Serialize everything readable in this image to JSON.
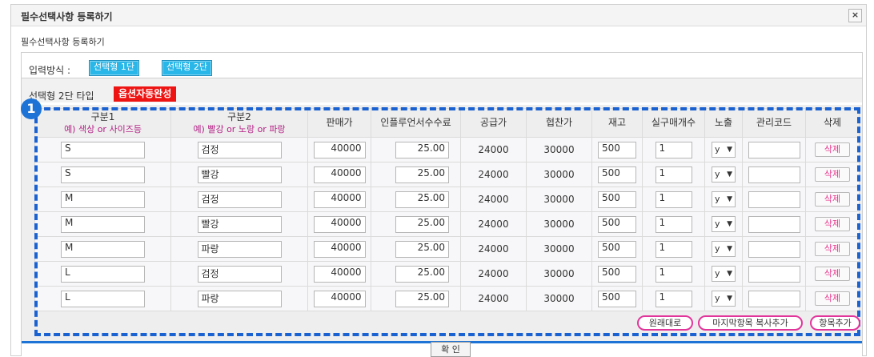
{
  "window": {
    "title": "필수선택사항 등록하기",
    "close_symbol": "×"
  },
  "subtitle": "필수선택사항 등록하기",
  "input_method": {
    "label": "입력방식 :",
    "buttons": [
      "선택형 1단",
      "선택형 2단"
    ]
  },
  "type_row": {
    "label": "선택형 2단 타입",
    "auto_button": "옵션자동완성"
  },
  "badge": "1",
  "table": {
    "headers": {
      "col1": "구분1",
      "col1_sub": "예) 색상 or 사이즈등",
      "col2": "구분2",
      "col2_sub": "예) 빨강 or 노랑 or 파랑",
      "price": "판매가",
      "fee": "인플루언서수수료",
      "supply": "공급가",
      "sponsor": "협찬가",
      "stock": "재고",
      "min_qty": "실구매개수",
      "expose": "노출",
      "code": "관리코드",
      "delete": "삭제"
    },
    "rows": [
      {
        "opt1": "S",
        "opt2": "검정",
        "price": "40000",
        "fee": "25.00",
        "supply": "24000",
        "sponsor": "30000",
        "stock": "500",
        "min_qty": "1",
        "expose": "y",
        "code": "",
        "delete": "삭제"
      },
      {
        "opt1": "S",
        "opt2": "빨강",
        "price": "40000",
        "fee": "25.00",
        "supply": "24000",
        "sponsor": "30000",
        "stock": "500",
        "min_qty": "1",
        "expose": "y",
        "code": "",
        "delete": "삭제"
      },
      {
        "opt1": "M",
        "opt2": "검정",
        "price": "40000",
        "fee": "25.00",
        "supply": "24000",
        "sponsor": "30000",
        "stock": "500",
        "min_qty": "1",
        "expose": "y",
        "code": "",
        "delete": "삭제"
      },
      {
        "opt1": "M",
        "opt2": "빨강",
        "price": "40000",
        "fee": "25.00",
        "supply": "24000",
        "sponsor": "30000",
        "stock": "500",
        "min_qty": "1",
        "expose": "y",
        "code": "",
        "delete": "삭제"
      },
      {
        "opt1": "M",
        "opt2": "파랑",
        "price": "40000",
        "fee": "25.00",
        "supply": "24000",
        "sponsor": "30000",
        "stock": "500",
        "min_qty": "1",
        "expose": "y",
        "code": "",
        "delete": "삭제"
      },
      {
        "opt1": "L",
        "opt2": "검정",
        "price": "40000",
        "fee": "25.00",
        "supply": "24000",
        "sponsor": "30000",
        "stock": "500",
        "min_qty": "1",
        "expose": "y",
        "code": "",
        "delete": "삭제"
      },
      {
        "opt1": "L",
        "opt2": "파랑",
        "price": "40000",
        "fee": "25.00",
        "supply": "24000",
        "sponsor": "30000",
        "stock": "500",
        "min_qty": "1",
        "expose": "y",
        "code": "",
        "delete": "삭제"
      }
    ]
  },
  "actions": {
    "reset": "원래대로",
    "copy_last": "마지막항목 복사추가",
    "add": "항목추가"
  },
  "confirm": "확 인",
  "icons": {
    "chevron": "chevron-down-icon",
    "close": "close-icon"
  },
  "colors": {
    "accent_blue": "#29b6e8",
    "accent_red": "#ee1414",
    "highlight_blue": "#1a61d1",
    "pink": "#e2359b"
  }
}
